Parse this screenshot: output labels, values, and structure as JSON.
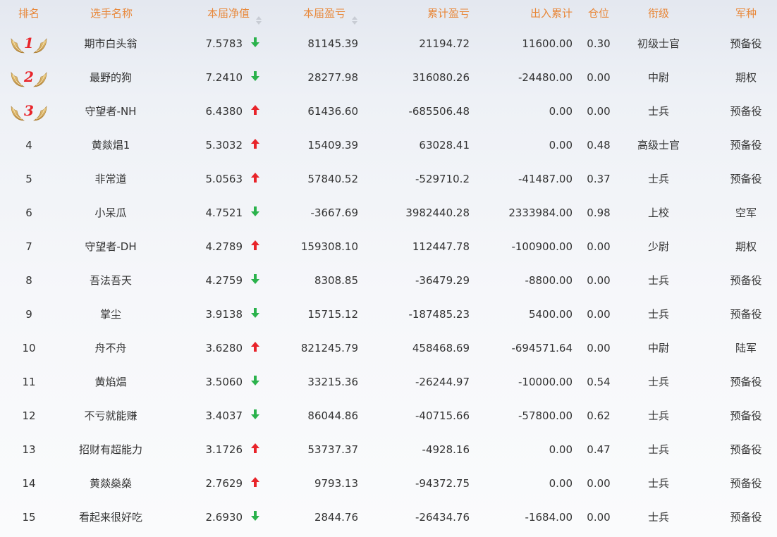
{
  "header": {
    "rank": "排名",
    "name": "选手名称",
    "nav": "本届净值",
    "pl": "本届盈亏",
    "cumulative": "累计盈亏",
    "inout": "出入累计",
    "position": "仓位",
    "title_rank": "衔级",
    "arm": "军种",
    "sort_icon": "sort-both-icon"
  },
  "colors": {
    "header_text": "#e8883a",
    "up_arrow": "#e8242a",
    "down_arrow": "#2bb24c",
    "medal_number": "#e8242a"
  },
  "rows": [
    {
      "rank": "1",
      "medal": true,
      "name": "期市白头翁",
      "nav": "7.5783",
      "trend": "down",
      "pl": "81145.39",
      "cumulative": "21194.72",
      "inout": "11600.00",
      "position": "0.30",
      "title_rank": "初级士官",
      "arm": "预备役"
    },
    {
      "rank": "2",
      "medal": true,
      "name": "最野的狗",
      "nav": "7.2410",
      "trend": "down",
      "pl": "28277.98",
      "cumulative": "316080.26",
      "inout": "-24480.00",
      "position": "0.00",
      "title_rank": "中尉",
      "arm": "期权"
    },
    {
      "rank": "3",
      "medal": true,
      "name": "守望者-NH",
      "nav": "6.4380",
      "trend": "up",
      "pl": "61436.60",
      "cumulative": "-685506.48",
      "inout": "0.00",
      "position": "0.00",
      "title_rank": "士兵",
      "arm": "预备役"
    },
    {
      "rank": "4",
      "medal": false,
      "name": "黄燚焻1",
      "nav": "5.3032",
      "trend": "up",
      "pl": "15409.39",
      "cumulative": "63028.41",
      "inout": "0.00",
      "position": "0.48",
      "title_rank": "高级士官",
      "arm": "预备役"
    },
    {
      "rank": "5",
      "medal": false,
      "name": "非常道",
      "nav": "5.0563",
      "trend": "up",
      "pl": "57840.52",
      "cumulative": "-529710.2",
      "inout": "-41487.00",
      "position": "0.37",
      "title_rank": "士兵",
      "arm": "预备役"
    },
    {
      "rank": "6",
      "medal": false,
      "name": "小呆瓜",
      "nav": "4.7521",
      "trend": "down",
      "pl": "-3667.69",
      "cumulative": "3982440.28",
      "inout": "2333984.00",
      "position": "0.98",
      "title_rank": "上校",
      "arm": "空军"
    },
    {
      "rank": "7",
      "medal": false,
      "name": "守望者-DH",
      "nav": "4.2789",
      "trend": "up",
      "pl": "159308.10",
      "cumulative": "112447.78",
      "inout": "-100900.00",
      "position": "0.00",
      "title_rank": "少尉",
      "arm": "期权"
    },
    {
      "rank": "8",
      "medal": false,
      "name": "吾法吾天",
      "nav": "4.2759",
      "trend": "down",
      "pl": "8308.85",
      "cumulative": "-36479.29",
      "inout": "-8800.00",
      "position": "0.00",
      "title_rank": "士兵",
      "arm": "预备役"
    },
    {
      "rank": "9",
      "medal": false,
      "name": "掌尘",
      "nav": "3.9138",
      "trend": "down",
      "pl": "15715.12",
      "cumulative": "-187485.23",
      "inout": "5400.00",
      "position": "0.00",
      "title_rank": "士兵",
      "arm": "预备役"
    },
    {
      "rank": "10",
      "medal": false,
      "name": "舟不舟",
      "nav": "3.6280",
      "trend": "up",
      "pl": "821245.79",
      "cumulative": "458468.69",
      "inout": "-694571.64",
      "position": "0.00",
      "title_rank": "中尉",
      "arm": "陆军"
    },
    {
      "rank": "11",
      "medal": false,
      "name": "黄焰焻",
      "nav": "3.5060",
      "trend": "down",
      "pl": "33215.36",
      "cumulative": "-26244.97",
      "inout": "-10000.00",
      "position": "0.54",
      "title_rank": "士兵",
      "arm": "预备役"
    },
    {
      "rank": "12",
      "medal": false,
      "name": "不亏就能赚",
      "nav": "3.4037",
      "trend": "down",
      "pl": "86044.86",
      "cumulative": "-40715.66",
      "inout": "-57800.00",
      "position": "0.62",
      "title_rank": "士兵",
      "arm": "预备役"
    },
    {
      "rank": "13",
      "medal": false,
      "name": "招财有超能力",
      "nav": "3.1726",
      "trend": "up",
      "pl": "53737.37",
      "cumulative": "-4928.16",
      "inout": "0.00",
      "position": "0.47",
      "title_rank": "士兵",
      "arm": "预备役"
    },
    {
      "rank": "14",
      "medal": false,
      "name": "黄燚燊燊",
      "nav": "2.7629",
      "trend": "up",
      "pl": "9793.13",
      "cumulative": "-94372.75",
      "inout": "0.00",
      "position": "0.00",
      "title_rank": "士兵",
      "arm": "预备役"
    },
    {
      "rank": "15",
      "medal": false,
      "name": "看起来很好吃",
      "nav": "2.6930",
      "trend": "down",
      "pl": "2844.76",
      "cumulative": "-26434.76",
      "inout": "-1684.00",
      "position": "0.00",
      "title_rank": "士兵",
      "arm": "预备役"
    }
  ]
}
